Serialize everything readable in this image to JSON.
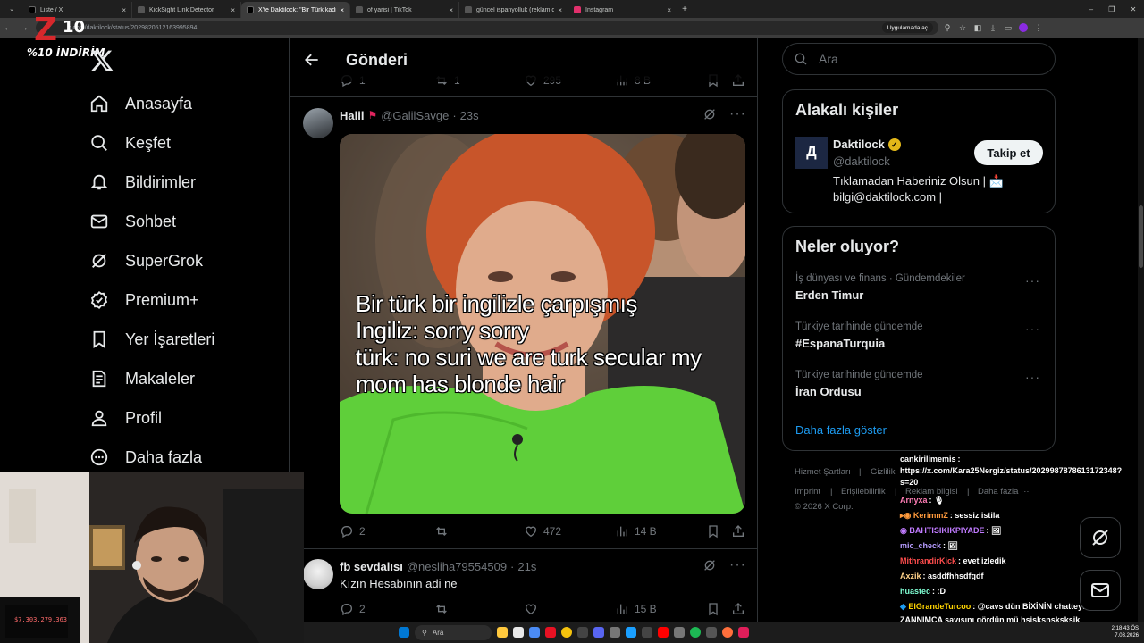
{
  "browser": {
    "tabs": [
      {
        "label": "Liste / X",
        "color": "#000000"
      },
      {
        "label": "KickSight Link Detector",
        "color": "#333333"
      },
      {
        "label": "X'te Daktilock: \"Bir Türk kadın, Y",
        "color": "#000000"
      },
      {
        "label": "of yarisi | TikTok",
        "color": "#111111"
      },
      {
        "label": "güncel ispanyolluk (reklam de...",
        "color": "#222222"
      },
      {
        "label": "Instagram",
        "color": "#e1306c"
      }
    ],
    "url": "x.com/daktilock/status/2029820512163995894",
    "open_app_label": "Uygulamada aç"
  },
  "overlay_logo": {
    "brand": "Z",
    "number": "10",
    "subtitle": "%10 İNDİRİM"
  },
  "sidebar": {
    "items": [
      {
        "label": "Anasayfa",
        "icon": "home-icon"
      },
      {
        "label": "Keşfet",
        "icon": "search-icon"
      },
      {
        "label": "Bildirimler",
        "icon": "bell-icon"
      },
      {
        "label": "Sohbet",
        "icon": "mail-icon"
      },
      {
        "label": "SuperGrok",
        "icon": "grok-icon"
      },
      {
        "label": "Premium+",
        "icon": "verified-icon"
      },
      {
        "label": "Yer İşaretleri",
        "icon": "bookmark-icon"
      },
      {
        "label": "Makaleler",
        "icon": "article-icon"
      },
      {
        "label": "Profil",
        "icon": "person-icon"
      },
      {
        "label": "Daha fazla",
        "icon": "more-circle-icon"
      }
    ]
  },
  "header": {
    "title": "Gönderi"
  },
  "prev_tweet_actions": {
    "replies": "1",
    "reposts": "1",
    "likes": "295",
    "views": "8 B"
  },
  "tweet1": {
    "name": "Halil",
    "handle": "@GalilSavge",
    "time": "23s",
    "meme_lines": [
      "Bir türk bir ingilizle çarpışmış",
      "Ingiliz: sorry sorry",
      "türk: no suri we are turk secular my",
      "mom has blonde hair"
    ],
    "replies": "2",
    "reposts": "",
    "likes": "472",
    "views": "14 B"
  },
  "tweet2": {
    "name": "fb sevdalısı",
    "handle": "@nesliha79554509",
    "time": "21s",
    "text": "Kızın Hesabının adi ne",
    "replies": "2",
    "reposts": "",
    "likes": "",
    "views": "15 B"
  },
  "search": {
    "placeholder": "Ara"
  },
  "related": {
    "title": "Alakalı kişiler",
    "name": "Daktilock",
    "handle": "@daktilock",
    "bio_line1": "Tıklamadan Haberiniz Olsun | 📩",
    "bio_line2": "bilgi@daktilock.com |",
    "follow_label": "Takip et"
  },
  "trends": {
    "title": "Neler oluyor?",
    "items": [
      {
        "category": "İş dünyası ve finans · Gündemdekiler",
        "name": "Erden Timur"
      },
      {
        "category": "Türkiye tarihinde gündemde",
        "name": "#EspanaTurquia"
      },
      {
        "category": "Türkiye tarihinde gündemde",
        "name": "İran Ordusu"
      }
    ],
    "show_more": "Daha fazla göster"
  },
  "footer": {
    "row1": [
      "Hizmet Şartları",
      "Gizlilik"
    ],
    "row2": [
      "Imprint",
      "Erişilebilirlik",
      "Reklam bilgisi",
      "Daha fazla ···"
    ],
    "copyright": "© 2026 X Corp."
  },
  "chat": [
    {
      "user": "cankirilimemis",
      "text": ":",
      "color": "#ffffff"
    },
    {
      "user": "",
      "text": "https://x.com/Kara25Nergiz/status/2029987878613172348?",
      "color": "#ffffff"
    },
    {
      "user": "",
      "text": "s=20",
      "color": "#ffffff"
    },
    {
      "user": "Arnyxa",
      "text": ": 🎙",
      "color": "#ff7eb6"
    },
    {
      "user": "KerimmZ",
      "text": ": sessiz istila",
      "color": "#ff9a3c"
    },
    {
      "user": "BAHTISIKIKPIYADE",
      "text": ": 🖼",
      "color": "#c07bff"
    },
    {
      "user": "mic_check",
      "text": ": 🖼",
      "color": "#b69cff"
    },
    {
      "user": "MithrandirKick",
      "text": ": evet izledik",
      "color": "#ff4d4d"
    },
    {
      "user": "Axzik",
      "text": ": asddfhhsdfgdf",
      "color": "#ffd28a"
    },
    {
      "user": "huastec",
      "text": ": :D",
      "color": "#7fffd4"
    },
    {
      "user": "ElGrandeTurcoo",
      "text": ": @cavs dün BİXİNİN chatteydin",
      "color": "#ffd400"
    },
    {
      "user": "",
      "text": "ZANNIMCA sayısını gördün mü hsjsksnsksksjk",
      "color": "#ffffff"
    },
    {
      "user": "mic_check",
      "text": ": 🖼",
      "color": "#b69cff"
    }
  ],
  "taskbar": {
    "search": "Ara",
    "time": "2:18:43 ÖS",
    "date": "7.03.2026"
  },
  "webcam": {
    "donation_counter": "$7,303,279,363"
  },
  "colors": {
    "accent": "#1d9bf0",
    "brand_red": "#d8282c",
    "verified_gold": "#e2b719"
  }
}
